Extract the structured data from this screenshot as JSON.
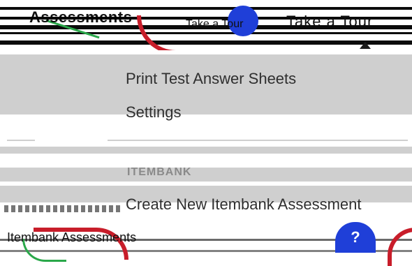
{
  "header": {
    "title": "Assessments",
    "link": "Take a Tour",
    "right_text": "Take a Tour"
  },
  "menu": {
    "items": [
      {
        "label": "Print Test Answer Sheets"
      },
      {
        "label": "Settings"
      }
    ],
    "section_label": "ITEMBANK",
    "section_items": [
      {
        "label": "Create New Itembank Assessment"
      }
    ]
  },
  "footer": {
    "text": "Itembank Assessments",
    "help_label": "?"
  },
  "colors": {
    "accent_blue": "#1f3fd8",
    "accent_red": "#c81d2a",
    "accent_green": "#2aa84a",
    "band_gray": "#cfcfcf"
  }
}
